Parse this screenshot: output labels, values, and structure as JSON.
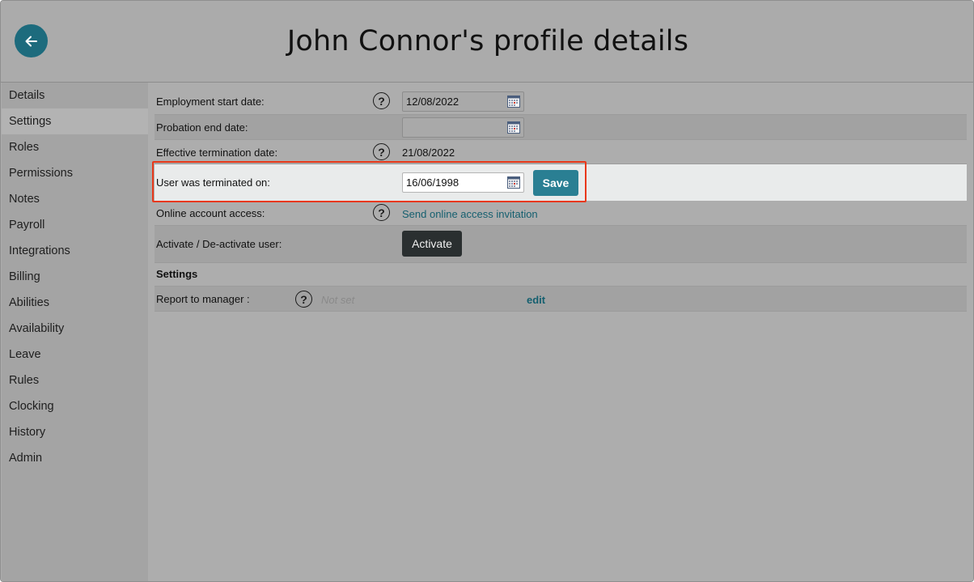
{
  "header": {
    "title": "John Connor's profile details"
  },
  "sidebar": {
    "items": [
      {
        "label": "Details"
      },
      {
        "label": "Settings",
        "active": true
      },
      {
        "label": "Roles"
      },
      {
        "label": "Permissions"
      },
      {
        "label": "Notes"
      },
      {
        "label": "Payroll"
      },
      {
        "label": "Integrations"
      },
      {
        "label": "Billing"
      },
      {
        "label": "Abilities"
      },
      {
        "label": "Availability"
      },
      {
        "label": "Leave"
      },
      {
        "label": "Rules"
      },
      {
        "label": "Clocking"
      },
      {
        "label": "History"
      },
      {
        "label": "Admin"
      }
    ]
  },
  "form": {
    "employment_start": {
      "label": "Employment start date:",
      "value": "12/08/2022"
    },
    "probation_end": {
      "label": "Probation end date:",
      "value": ""
    },
    "effective_termination": {
      "label": "Effective termination date:",
      "value": "21/08/2022"
    },
    "terminated_on": {
      "label": "User was terminated on:",
      "value": "16/06/1998",
      "save_label": "Save"
    },
    "online_access": {
      "label": "Online account access:",
      "link": "Send online access invitation"
    },
    "activate": {
      "label": "Activate / De-activate user:",
      "button": "Activate"
    }
  },
  "settings": {
    "heading": "Settings",
    "report_to_manager": {
      "label": "Report to manager :",
      "value": "Not set",
      "edit_label": "edit"
    }
  },
  "icons": {
    "back": "arrow-left-icon",
    "help": "question-circle-icon",
    "calendar": "calendar-icon"
  },
  "colors": {
    "accent": "#2a7f93",
    "highlight": "#e8381a",
    "link": "#145f6f"
  }
}
